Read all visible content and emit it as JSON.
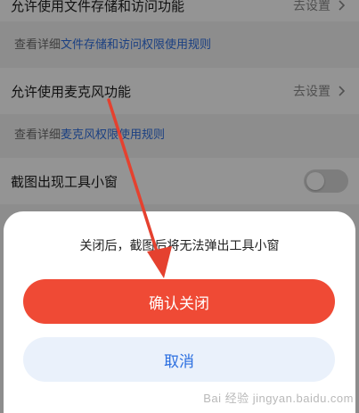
{
  "settings": {
    "rows": [
      {
        "label": "允许使用文件存储和访问功能",
        "action": "去设置"
      },
      {
        "label": "允许使用麦克风功能",
        "action": "去设置"
      },
      {
        "label": "截图出现工具小窗"
      }
    ],
    "notes": [
      {
        "prefix": "查看详细",
        "link": "文件存储和访问权限使用规则"
      },
      {
        "prefix": "查看详细",
        "link": "麦克风权限使用规则"
      }
    ],
    "toggle_state": "off"
  },
  "dialog": {
    "message": "关闭后，截图后将无法弹出工具小窗",
    "confirm_label": "确认关闭",
    "cancel_label": "取消"
  },
  "colors": {
    "confirm": "#ef4a35",
    "cancel_bg": "#eaf1fb",
    "link": "#2f6fe0",
    "arrow": "#e5412f"
  },
  "watermark": "Bai 经验 jingyan.baidu.com"
}
